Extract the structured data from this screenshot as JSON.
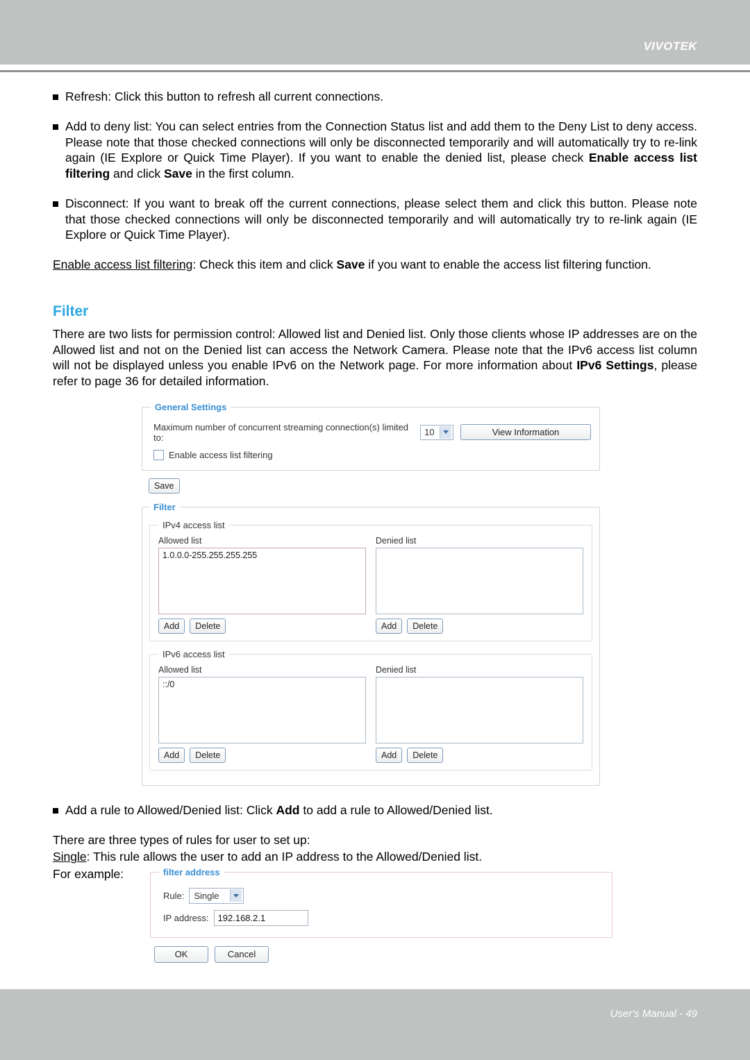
{
  "header": {
    "brand": "VIVOTEK"
  },
  "footer": {
    "text": "User's Manual - 49"
  },
  "bullets": {
    "refresh_lead": "Refresh:",
    "refresh_rest": " Click this button to refresh all current connections.",
    "deny_lead": "Add to deny list:",
    "deny_part1": " You can select entries from the Connection Status list and add them to the Deny List to deny access. Please note that those checked connections will only be disconnected temporarily and will automatically try to re-link again (IE Explore or Quick Time Player). If you want to enable the denied list, please check ",
    "deny_bold1": "Enable access list filtering",
    "deny_part2": " and click ",
    "deny_bold2": "Save",
    "deny_part3": " in the first column.",
    "disconnect_lead": "Disconnect:",
    "disconnect_rest": " If you want to break off the current connections, please select them and click this button. Please note that those checked connections will only be disconnected temporarily and will automatically try to re-link again (IE Explore or Quick Time Player).",
    "add_rule_part1": "Add a rule to Allowed/Denied list: Click ",
    "add_rule_bold": "Add",
    "add_rule_part2": " to add a rule to Allowed/Denied list."
  },
  "enable_filtering_para": {
    "underlined": "Enable access list filtering",
    "part1": ": Check this item and click ",
    "bold": "Save",
    "part2": " if you want to enable the access list filtering function."
  },
  "filter_section": {
    "title": "Filter",
    "paragraph_part1": "There are two lists for permission control: Allowed list and Denied list. Only those clients whose IP addresses are on the Allowed list and not on the Denied list can access the Network Camera. Please note that the IPv6 access list column will not be displayed unless you enable IPv6 on the Network page. For more information about ",
    "paragraph_bold": "IPv6 Settings",
    "paragraph_part2": ", please refer to page 36 for detailed information."
  },
  "rules_intro": {
    "line1": "There are three types of rules for user to set up:",
    "single_label": "Single",
    "single_rest": ": This rule allows the user to add an IP address to the Allowed/Denied list.",
    "for_example": "For example:"
  },
  "general_settings": {
    "legend": "General Settings",
    "max_conn_label": "Maximum number of concurrent streaming connection(s) limited to:",
    "max_conn_value": "10",
    "view_information_button": "View Information",
    "enable_filtering_checkbox": "Enable access list filtering",
    "checkbox_checked": false,
    "save_button": "Save"
  },
  "filter_panel": {
    "legend": "Filter",
    "ipv4": {
      "legend": "IPv4 access list",
      "allowed_label": "Allowed list",
      "denied_label": "Denied list",
      "allowed_value": "1.0.0.0-255.255.255.255",
      "denied_value": "",
      "add_button": "Add",
      "delete_button": "Delete"
    },
    "ipv6": {
      "legend": "IPv6 access list",
      "allowed_label": "Allowed list",
      "denied_label": "Denied list",
      "allowed_value": "::/0",
      "denied_value": "",
      "add_button": "Add",
      "delete_button": "Delete"
    }
  },
  "filter_address": {
    "legend": "filter address",
    "rule_label": "Rule:",
    "rule_value": "Single",
    "ip_label": "IP address:",
    "ip_value": "192.168.2.1",
    "ok_button": "OK",
    "cancel_button": "Cancel"
  },
  "colors": {
    "header_gray": "#c0c2c2",
    "accent_blue": "#2ba7e0",
    "legend_blue": "#3a8fd4"
  }
}
